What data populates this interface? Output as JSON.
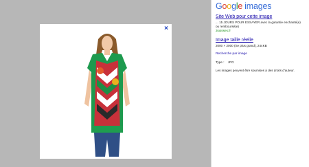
{
  "logo": {
    "brand": "Google",
    "product": "images"
  },
  "result": {
    "site_link": "Site Web pour cette image",
    "snippet": "... 15 JOURS POUR ESSAYER avec la garantie enchanté(e) ou remboursé(e)",
    "domain": "3suisses.fr"
  },
  "full_image": {
    "link": "Image taille réelle",
    "dims": "2000 × 2000 (Se plus grand), 244KB"
  },
  "search_by_image": "Recherche par image",
  "type_label": "Type :",
  "type_value": "JPG",
  "notice": "Les images peuvent être soumises à des droits d'auteur.",
  "close_glyph": "×"
}
